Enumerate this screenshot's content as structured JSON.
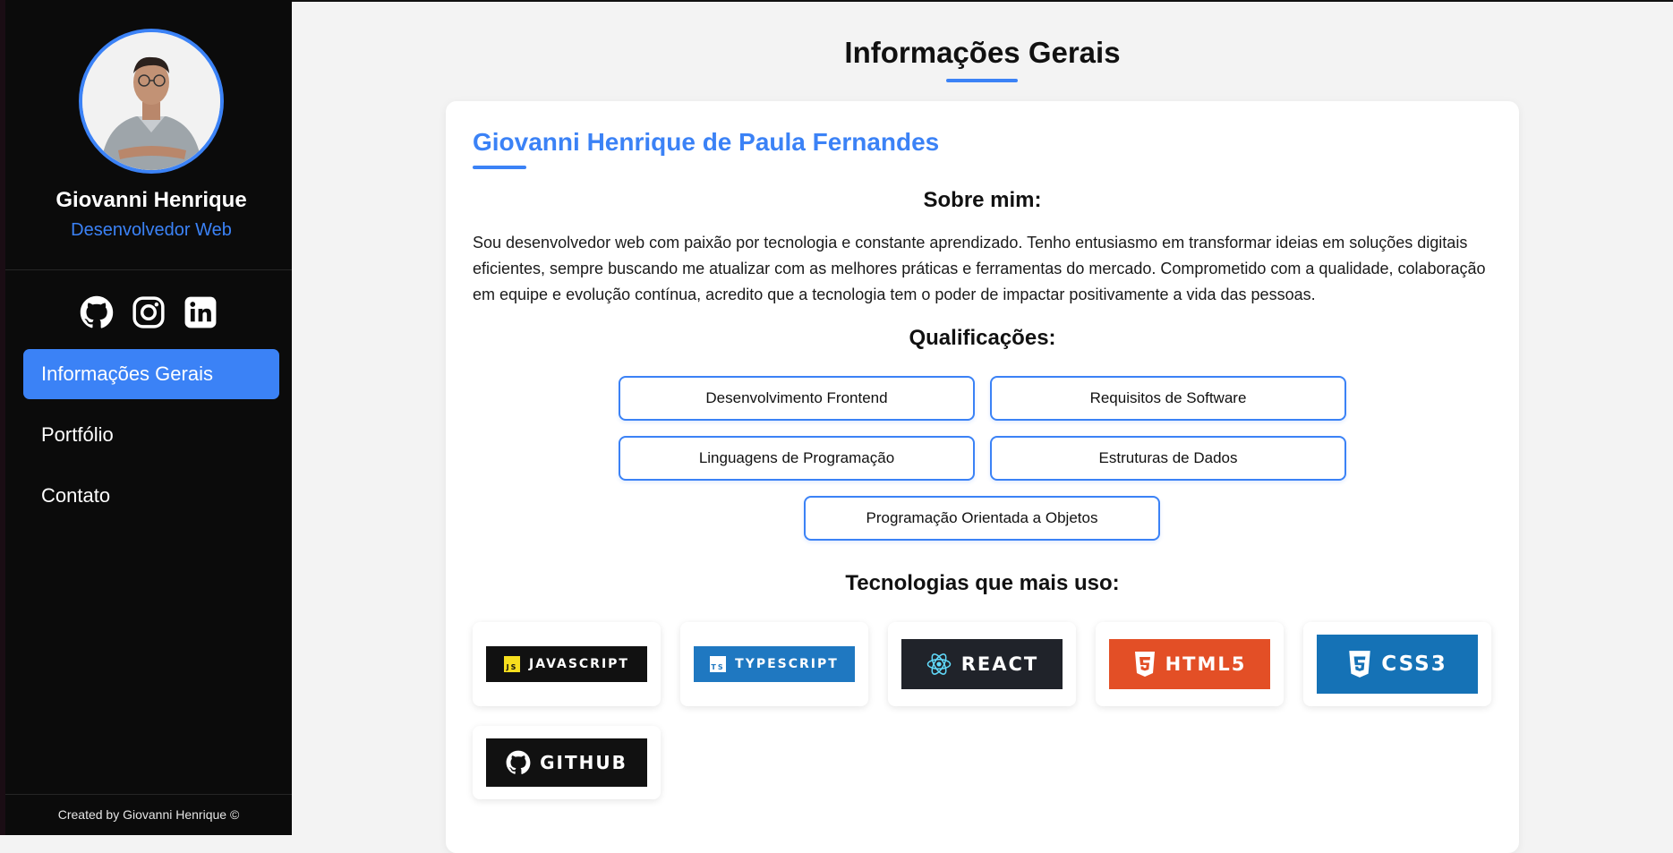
{
  "sidebar": {
    "name": "Giovanni Henrique",
    "role": "Desenvolvedor Web",
    "socials": [
      "github-icon",
      "instagram-icon",
      "linkedin-icon"
    ],
    "nav": [
      {
        "label": "Informações Gerais",
        "active": true
      },
      {
        "label": "Portfólio",
        "active": false
      },
      {
        "label": "Contato",
        "active": false
      }
    ],
    "footer": "Created by Giovanni Henrique ©"
  },
  "main": {
    "title": "Informações Gerais",
    "full_name": "Giovanni Henrique de Paula Fernandes",
    "about_heading": "Sobre mim:",
    "about_text": "Sou desenvolvedor web com paixão por tecnologia e constante aprendizado. Tenho entusiasmo em transformar ideias em soluções digitais eficientes, sempre buscando me atualizar com as melhores práticas e ferramentas do mercado. Comprometido com a qualidade, colaboração em equipe e evolução contínua, acredito que a tecnologia tem o poder de impactar positivamente a vida das pessoas.",
    "qualifications_heading": "Qualificações:",
    "qualifications": [
      "Desenvolvimento Frontend",
      "Requisitos de Software",
      "Linguagens de Programação",
      "Estruturas de Dados",
      "Programação Orientada a Objetos"
    ],
    "tech_heading": "Tecnologias que mais uso:",
    "technologies": [
      {
        "label": "JAVASCRIPT",
        "icon": "js-icon",
        "color": "#111111"
      },
      {
        "label": "TYPESCRIPT",
        "icon": "ts-icon",
        "color": "#1f78c1"
      },
      {
        "label": "REACT",
        "icon": "react-icon",
        "color": "#20232a"
      },
      {
        "label": "HTML5",
        "icon": "html5-icon",
        "color": "#e34f26"
      },
      {
        "label": "CSS3",
        "icon": "css3-icon",
        "color": "#1572b6"
      },
      {
        "label": "GITHUB",
        "icon": "github-icon",
        "color": "#111111"
      }
    ]
  },
  "colors": {
    "accent": "#3b82f6",
    "sidebar_bg": "#0b0b0b",
    "main_bg": "#f3f3f3"
  }
}
